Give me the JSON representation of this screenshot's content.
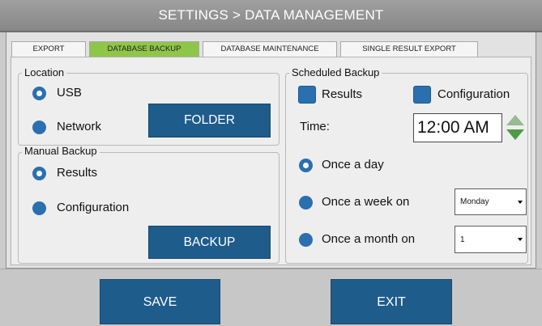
{
  "title": "SETTINGS > DATA MANAGEMENT",
  "tabs": [
    {
      "label": "EXPORT",
      "active": false
    },
    {
      "label": "DATABASE BACKUP",
      "active": true
    },
    {
      "label": "DATABASE MAINTENANCE",
      "active": false
    },
    {
      "label": "SINGLE RESULT EXPORT",
      "active": false
    }
  ],
  "location": {
    "legend": "Location",
    "options": [
      {
        "label": "USB",
        "selected": true
      },
      {
        "label": "Network",
        "selected": false
      }
    ],
    "folder_button": "FOLDER"
  },
  "manual_backup": {
    "legend": "Manual Backup",
    "options": [
      {
        "label": "Results",
        "selected": true
      },
      {
        "label": "Configuration",
        "selected": false
      }
    ],
    "backup_button": "BACKUP"
  },
  "scheduled_backup": {
    "legend": "Scheduled Backup",
    "checkboxes": [
      {
        "label": "Results"
      },
      {
        "label": "Configuration"
      }
    ],
    "time_label": "Time:",
    "time_value": "12:00 AM",
    "frequency": [
      {
        "label": "Once a day",
        "selected": true
      },
      {
        "label": "Once a week on",
        "selected": false,
        "select_value": "Monday"
      },
      {
        "label": "Once a month on",
        "selected": false,
        "select_value": "1"
      }
    ]
  },
  "footer": {
    "save_label": "SAVE",
    "exit_label": "EXIT"
  },
  "icons": {
    "time_increment": "arrow-up-icon",
    "time_decrement": "arrow-down-icon",
    "dropdown": "chevron-down-icon"
  },
  "colors": {
    "button": "#1e5c8b",
    "active_tab": "#8fc649",
    "radio": "#2a70b0",
    "title_bar": "#878787"
  }
}
